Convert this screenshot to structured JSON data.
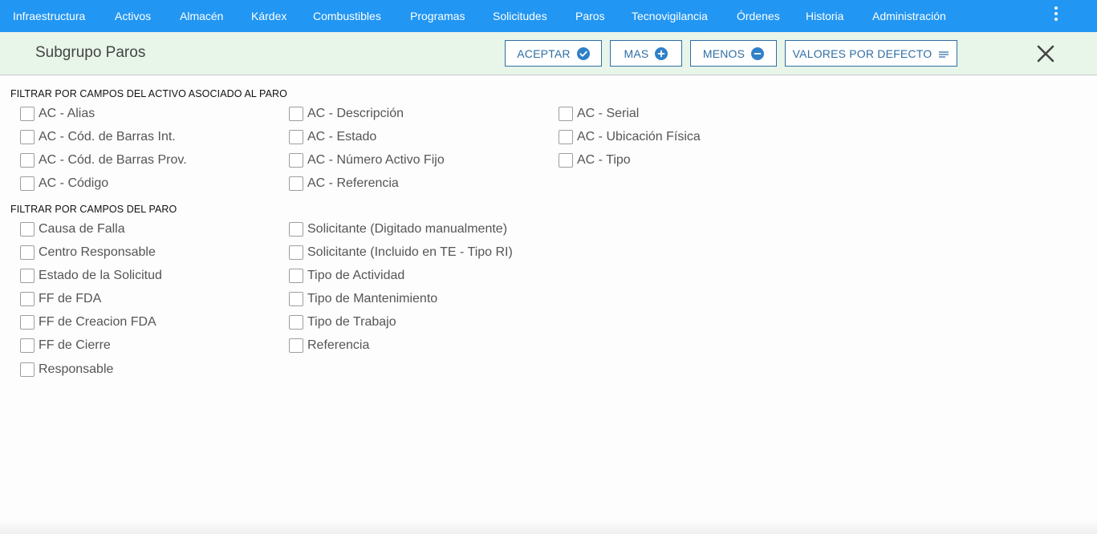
{
  "nav": {
    "items": [
      "Infraestructura",
      "Activos",
      "Almacén",
      "Kárdex",
      "Combustibles",
      "Programas",
      "Solicitudes",
      "Paros",
      "Tecnovigilancia",
      "Órdenes",
      "Historia",
      "Administración"
    ]
  },
  "toolbar": {
    "title": "Subgrupo Paros",
    "accept_label": "ACEPTAR",
    "more_label": "MAS",
    "less_label": "MENOS",
    "defaults_label": "VALORES POR DEFECTO"
  },
  "sections": {
    "asset": {
      "title": "FILTRAR POR CAMPOS DEL ACTIVO ASOCIADO AL PARO",
      "col1": [
        "AC - Alias",
        "AC - Cód. de Barras Int.",
        "AC - Cód. de Barras Prov.",
        "AC - Código"
      ],
      "col2": [
        "AC - Descripción",
        "AC - Estado",
        "AC - Número Activo Fijo",
        "AC - Referencia"
      ],
      "col3": [
        "AC - Serial",
        "AC - Ubicación Física",
        "AC - Tipo"
      ]
    },
    "stop": {
      "title": "FILTRAR POR CAMPOS DEL PARO",
      "col1": [
        "Causa de Falla",
        "Centro Responsable",
        "Estado de la Solicitud",
        "FF de FDA",
        "FF de Creacion FDA",
        "FF de Cierre",
        "Responsable"
      ],
      "col2": [
        "Solicitante (Digitado manualmente)",
        "Solicitante (Incluido en TE - Tipo RI)",
        "Tipo de Actividad",
        "Tipo de Mantenimiento",
        "Tipo de Trabajo",
        "Referencia"
      ]
    }
  },
  "colors": {
    "nav_bg": "#2196f3",
    "toolbar_bg": "#e8f5e9",
    "button_accent": "#2f6ea5"
  }
}
